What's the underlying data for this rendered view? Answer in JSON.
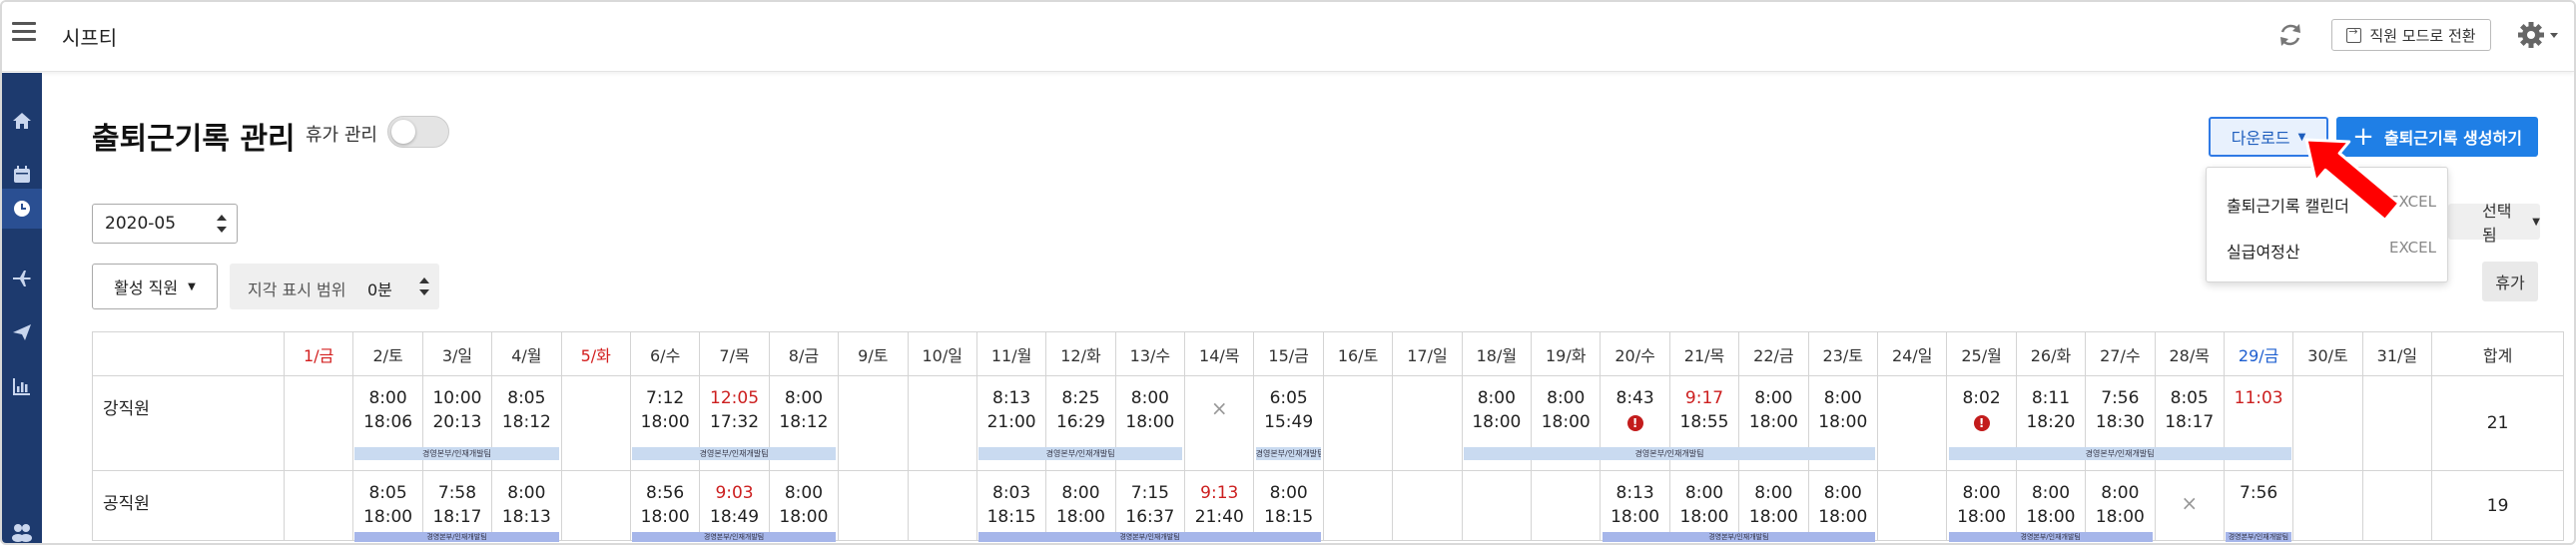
{
  "topbar": {
    "app_title": "시프티",
    "mode_switch_label": "직원 모드로 전환"
  },
  "sidebar": {
    "items": [
      "home-icon",
      "calendar-icon",
      "clock-icon",
      "airplane-icon",
      "send-icon",
      "chart-icon",
      "people-icon"
    ]
  },
  "page": {
    "title": "출퇴근기록 관리",
    "leave_label": "휴가 관리",
    "leave_toggle_on": false
  },
  "actions": {
    "download_label": "다운로드",
    "create_label": "출퇴근기록 생성하기"
  },
  "download_menu": {
    "items": [
      {
        "label": "출퇴근기록 캘린더",
        "tag": "EXCEL"
      },
      {
        "label": "실급여정산",
        "tag": "EXCEL"
      }
    ]
  },
  "filters": {
    "month": "2020-05",
    "status": "활성 직원",
    "late_range_label": "지각 표시 범위",
    "late_range_value": "0분",
    "selected_label": "선택됨",
    "vacation_label": "휴가"
  },
  "table": {
    "days": [
      "1/금",
      "2/토",
      "3/일",
      "4/월",
      "5/화",
      "6/수",
      "7/목",
      "8/금",
      "9/토",
      "10/일",
      "11/월",
      "12/화",
      "13/수",
      "14/목",
      "15/금",
      "16/토",
      "17/일",
      "18/월",
      "19/화",
      "20/수",
      "21/목",
      "22/금",
      "23/토",
      "24/일",
      "25/월",
      "26/화",
      "27/수",
      "28/목",
      "29/금",
      "30/토",
      "31/일"
    ],
    "red_days": [
      0,
      4
    ],
    "blue_days": [
      28
    ],
    "total_header": "합계",
    "rows": [
      {
        "name": "강직원",
        "total": "21",
        "cells": [
          null,
          {
            "in": "8:00",
            "out": "18:06"
          },
          {
            "in": "10:00",
            "out": "20:13"
          },
          {
            "in": "8:05",
            "out": "18:12"
          },
          null,
          {
            "in": "7:12",
            "out": "18:00"
          },
          {
            "in": "12:05",
            "out": "17:32",
            "late_in": true
          },
          {
            "in": "8:00",
            "out": "18:12"
          },
          null,
          null,
          {
            "in": "8:13",
            "out": "21:00"
          },
          {
            "in": "8:25",
            "out": "16:29"
          },
          {
            "in": "8:00",
            "out": "18:00"
          },
          {
            "x": true
          },
          {
            "in": "6:05",
            "out": "15:49"
          },
          null,
          null,
          {
            "in": "8:00",
            "out": "18:00"
          },
          {
            "in": "8:00",
            "out": "18:00"
          },
          {
            "in": "8:43",
            "warn": true
          },
          {
            "in": "9:17",
            "out": "18:55",
            "late_in": true
          },
          {
            "in": "8:00",
            "out": "18:00"
          },
          {
            "in": "8:00",
            "out": "18:00"
          },
          null,
          {
            "in": "8:02",
            "warn": true
          },
          {
            "in": "8:11",
            "out": "18:20"
          },
          {
            "in": "7:56",
            "out": "18:30"
          },
          {
            "in": "8:05",
            "out": "18:17"
          },
          {
            "in": "11:03",
            "late_in": true
          },
          null,
          null
        ],
        "bands": [
          {
            "from": 1,
            "to": 3,
            "text": "경영본부/인재개발팀"
          },
          {
            "from": 5,
            "to": 7,
            "text": "경영본부/인재개발팀"
          },
          {
            "from": 10,
            "to": 12,
            "text": "경영본부/인재개발팀"
          },
          {
            "from": 14,
            "to": 14,
            "text": "경영본부/인재개발팀"
          },
          {
            "from": 17,
            "to": 22,
            "text": "경영본부/인재개발팀"
          },
          {
            "from": 24,
            "to": 28,
            "text": "경영본부/인재개발팀"
          }
        ]
      },
      {
        "name": "공직원",
        "total": "19",
        "cells": [
          null,
          {
            "in": "8:05",
            "out": "18:00"
          },
          {
            "in": "7:58",
            "out": "18:17"
          },
          {
            "in": "8:00",
            "out": "18:13"
          },
          null,
          {
            "in": "8:56",
            "out": "18:00"
          },
          {
            "in": "9:03",
            "out": "18:49",
            "late_in": true
          },
          {
            "in": "8:00",
            "out": "18:00"
          },
          null,
          null,
          {
            "in": "8:03",
            "out": "18:15"
          },
          {
            "in": "8:00",
            "out": "18:00"
          },
          {
            "in": "7:15",
            "out": "16:37"
          },
          {
            "in": "9:13",
            "out": "21:40",
            "late_in": true
          },
          {
            "in": "8:00",
            "out": "18:15"
          },
          null,
          null,
          null,
          null,
          {
            "in": "8:13",
            "out": "18:00"
          },
          {
            "in": "8:00",
            "out": "18:00"
          },
          {
            "in": "8:00",
            "out": "18:00"
          },
          {
            "in": "8:00",
            "out": "18:00"
          },
          null,
          {
            "in": "8:00",
            "out": "18:00"
          },
          {
            "in": "8:00",
            "out": "18:00"
          },
          {
            "in": "8:00",
            "out": "18:00"
          },
          {
            "x": true
          },
          {
            "in": "7:56"
          },
          null,
          null
        ],
        "bands": [
          {
            "from": 1,
            "to": 3,
            "text": "경영본부/인재개발팀"
          },
          {
            "from": 5,
            "to": 7,
            "text": "경영본부/인재개발팀"
          },
          {
            "from": 10,
            "to": 14,
            "text": "경영본부/인재개발팀"
          },
          {
            "from": 19,
            "to": 22,
            "text": "경영본부/인재개발팀"
          },
          {
            "from": 24,
            "to": 26,
            "text": "경영본부/인재개발팀"
          },
          {
            "from": 28,
            "to": 28,
            "text": "경영본부/인재개발팀"
          }
        ]
      }
    ]
  }
}
